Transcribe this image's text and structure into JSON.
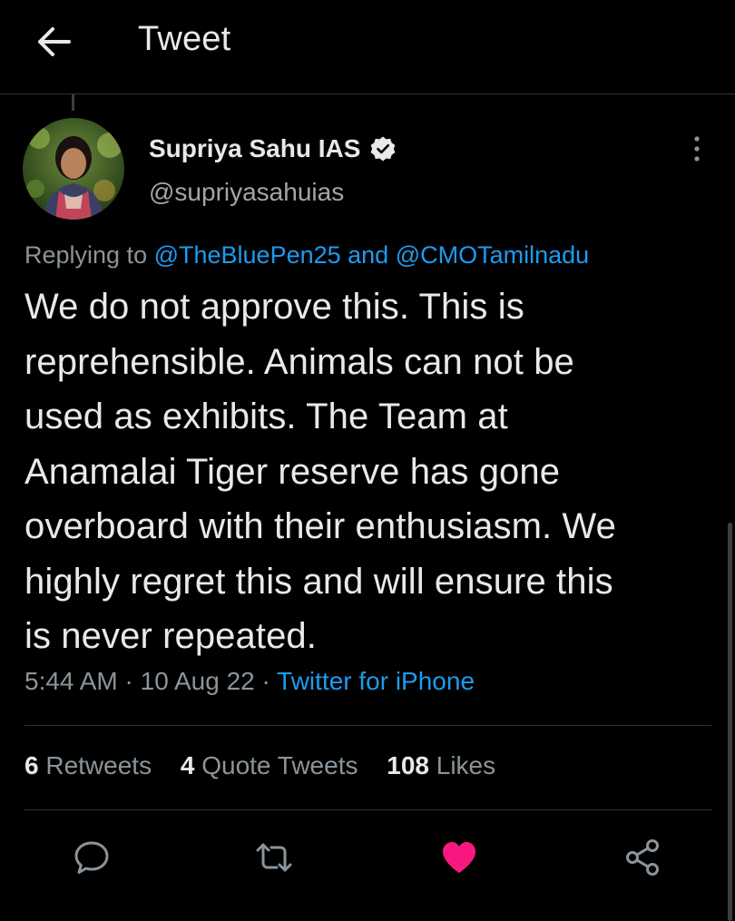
{
  "header": {
    "title": "Tweet",
    "back_icon": "arrow-left-icon"
  },
  "author": {
    "display_name": "Supriya Sahu IAS",
    "handle": "@supriyasahuias",
    "verified_icon": "verified-badge-icon",
    "more_icon": "vertical-dots-icon"
  },
  "reply": {
    "prefix": "Replying to ",
    "mention_1": "@TheBluePen25",
    "connector": " and ",
    "mention_2": "@CMOTamilnadu"
  },
  "tweet": {
    "lines": [
      "We do not approve this. This is",
      "reprehensible. Animals can not be",
      "used as exhibits. The Team at",
      "Anamalai Tiger reserve has gone",
      "overboard with their enthusiasm. We",
      "highly regret this and will ensure this",
      "is never repeated."
    ]
  },
  "meta": {
    "time": "5:44 AM",
    "sep_1": " · ",
    "date": "10 Aug 22",
    "sep_2": " · ",
    "source": "Twitter for iPhone"
  },
  "stats": {
    "retweets_count": "6",
    "retweets_label": " Retweets",
    "quotes_count": "4",
    "quotes_label": " Quote Tweets",
    "likes_count": "108",
    "likes_label": " Likes"
  },
  "actions": {
    "reply_icon": "reply-bubble-icon",
    "retweet_icon": "retweet-icon",
    "like_icon": "heart-filled-icon",
    "share_icon": "share-icon",
    "like_color": "#f91880"
  },
  "colors": {
    "background": "#000000",
    "text": "#e7e9ea",
    "muted": "#8b949a",
    "link": "#1d9bf0",
    "divider": "#2f3336"
  }
}
